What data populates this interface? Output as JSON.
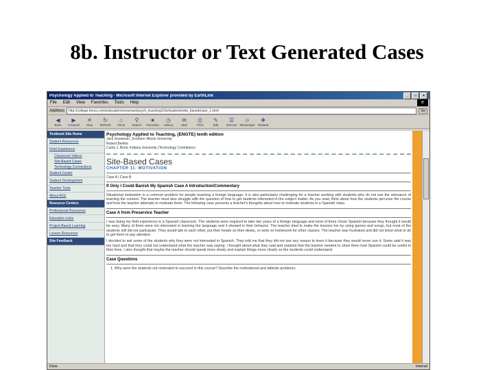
{
  "slide": {
    "title": "8b. Instructor or Text Generated Cases"
  },
  "window": {
    "title": "Psychology Applied to Teaching - Microsoft Internet Explorer provided by EarthLink",
    "controls": [
      "_",
      "□",
      "×"
    ]
  },
  "menu": [
    "File",
    "Edit",
    "View",
    "Favorites",
    "Tools",
    "Help"
  ],
  "address": {
    "label": "Address",
    "url": "http://college.hmco.com/education/snowman/psych_teaching/10e/students/site_based/case_1.html",
    "go": "Go"
  },
  "toolbar": [
    "Back",
    "Forward",
    "Stop",
    "Refresh",
    "Home",
    "Search",
    "Favorites",
    "History",
    "Mail",
    "Print",
    "Edit",
    "Discuss",
    "Messenger",
    "Related"
  ],
  "sidebar": {
    "items": [
      {
        "label": "Textbook Site Home",
        "kind": "head"
      },
      {
        "label": "Student Resources",
        "kind": "link"
      },
      {
        "label": "Field Experience",
        "kind": "link"
      },
      {
        "label": "Classroom Videos",
        "kind": "sub"
      },
      {
        "label": "Site-Based Cases",
        "kind": "sub"
      },
      {
        "label": "Technology Connections",
        "kind": "sub"
      },
      {
        "label": "Student Center",
        "kind": "link"
      },
      {
        "label": "Student Development",
        "kind": "link"
      },
      {
        "label": "Teacher Tools",
        "kind": "link"
      },
      {
        "label": "About ACE",
        "kind": "link"
      },
      {
        "label": "Resource Centers",
        "kind": "head"
      },
      {
        "label": "Professional Resources",
        "kind": "link"
      },
      {
        "label": "Education Links",
        "kind": "link"
      },
      {
        "label": "Project-Based Learning",
        "kind": "link"
      },
      {
        "label": "Lesson Resources",
        "kind": "link"
      },
      {
        "label": "Site Feedback",
        "kind": "head"
      }
    ]
  },
  "page": {
    "book_title": "Psychology Applied to Teaching, (ENGTE) tenth edition",
    "authors": [
      "Jack Snowman, Southern Illinois University",
      "Robert Biehler",
      "Curtis J. Bonk, Indiana University (Technology Contributor)"
    ],
    "section_title": "Site-Based Cases",
    "chapter": "CHAPTER 11: MOTIVATION",
    "case_links": "Case A | Case B",
    "case_heading": "If Only I Could Banish My Spanish Case A Introduction/Commentary",
    "intro": "Situational motivation is a common problem for people teaching a foreign language. It is also particularly challenging for a teacher working with students who do not see the relevance of learning the content. The teacher must also struggle with the question of how to get students interested in the subject matter. As you read, think about how the students perceive the course and how the teacher attempts to motivate them. The following case presents a teacher's thoughts about how to motivate students in a Spanish class.",
    "case_a_heading": "Case A from Preservice Teacher",
    "case_a_p1": "I was doing my field experience in a Spanish classroom. The students were required to take two years of a foreign language and most of them chose Spanish because they thought it would be easy. Many of them were not interested in learning the language and it showed in their behavior. The teacher tried to make the lessons fun by using games and songs, but most of the students still did not participate. They would talk to each other, put their heads on their desks, or work on homework for other classes. The teacher was frustrated and did not know what to do to get them to pay attention.",
    "case_a_p2": "I decided to ask some of the students why they were not interested in Spanish. They told me that they did not see any reason to learn it because they would never use it. Some said it was too hard and that they could not understand what the teacher was saying. I thought about what they said and realized that the teacher needed to show them how Spanish could be useful in their lives. I also thought that maybe the teacher should speak more slowly and explain things more clearly so the students could understand.",
    "questions_heading": "Case Questions",
    "question1": "1.  Why were the students not motivated to succeed in this course? Describe the motivational and attitude problems."
  },
  "status": {
    "left": "Done",
    "right": "Internet"
  }
}
